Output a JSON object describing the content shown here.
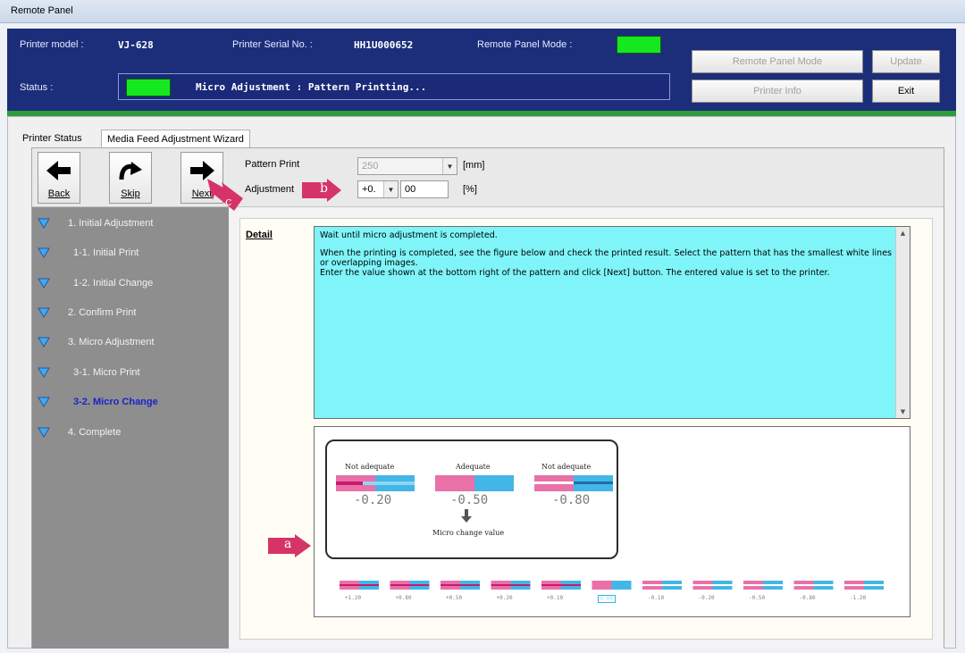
{
  "window": {
    "title": "Remote Panel"
  },
  "header": {
    "printer_model_label": "Printer model :",
    "printer_model": "VJ-628",
    "serial_label": "Printer Serial No. :",
    "serial": "HH1U000652",
    "mode_label": "Remote Panel Mode :",
    "status_label": "Status :",
    "status_text": "Micro Adjustment : Pattern Printting...",
    "lamp_color": "#16e81f",
    "buttons": {
      "remote_panel_mode": "Remote Panel Mode",
      "update": "Update",
      "printer_info": "Printer Info",
      "exit": "Exit"
    }
  },
  "tabs": [
    "Printer Status",
    "Media Feed Adjustment Wizard"
  ],
  "toolbar": {
    "back": "Back",
    "skip": "Skip",
    "next": "Next",
    "pattern_print_label": "Pattern Print",
    "pattern_print_value": "250",
    "pattern_print_unit": "[mm]",
    "adjustment_label": "Adjustment",
    "adjustment_sign": "+0.",
    "adjustment_value": "00",
    "adjustment_unit": "[%]"
  },
  "steps": [
    {
      "label": "1. Initial Adjustment"
    },
    {
      "label": "1-1.  Initial Print"
    },
    {
      "label": "1-2.  Initial Change"
    },
    {
      "label": "2.  Confirm Print"
    },
    {
      "label": "3. Micro Adjustment"
    },
    {
      "label": "3-1.  Micro Print"
    },
    {
      "label": "3-2.  Micro Change"
    },
    {
      "label": "4. Complete"
    }
  ],
  "current_step": "3-2.  Micro Change",
  "detail": {
    "label": "Detail",
    "para1": "Wait until micro adjustment is completed.",
    "para2": "When the printing is completed, see the figure below and check the printed result. Select the pattern that has the smallest white lines or overlapping images.",
    "para3": "Enter the value shown at the bottom right of the pattern and click [Next] button. The entered value is set to the printer."
  },
  "figure": {
    "not_adequate": "Not adequate",
    "adequate": "Adequate",
    "v1": "-0.20",
    "v2": "-0.50",
    "v3": "-0.80",
    "micro_change_value": "Micro change value",
    "pattern_values": [
      "+1.20",
      "+0.80",
      "+0.50",
      "+0.20",
      "+0.10",
      "0.00",
      "-0.10",
      "-0.20",
      "-0.50",
      "-0.80",
      "-1.20"
    ],
    "selected_value": "0.00"
  },
  "callouts": {
    "a": "a",
    "b": "b",
    "c": "c"
  },
  "colors": {
    "header_bg": "#1c2e7a",
    "accent_magenta": "#d63468",
    "pattern_pink": "#e971a8",
    "pattern_blue": "#43b6e8",
    "detail_bg": "#7ff5fa"
  }
}
